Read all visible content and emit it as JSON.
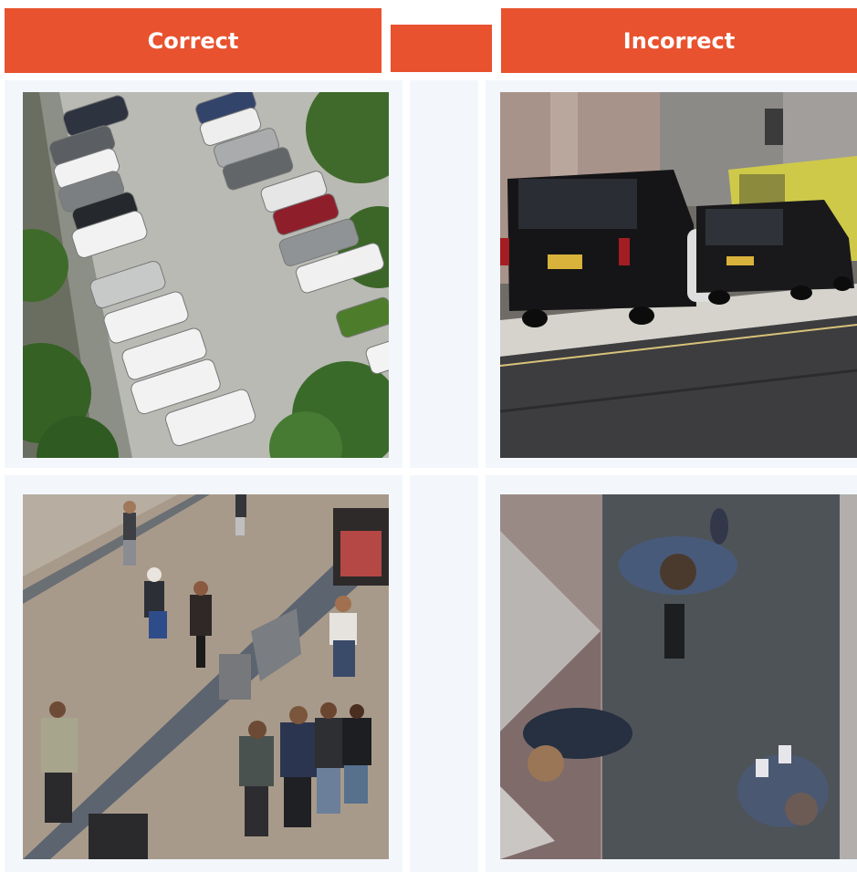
{
  "header": {
    "correct_label": "Correct",
    "middle_label": "",
    "incorrect_label": "Incorrect"
  },
  "colors": {
    "header_bg": "#e8522f",
    "header_text": "#ffffff",
    "row_bg": "#f3f7fc"
  },
  "rows": [
    {
      "correct_image": "aerial-parking-lot-photo",
      "incorrect_image": "street-level-vans-photo"
    },
    {
      "correct_image": "high-angle-pedestrian-street-photo",
      "incorrect_image": "top-down-pedestrians-photo"
    }
  ]
}
